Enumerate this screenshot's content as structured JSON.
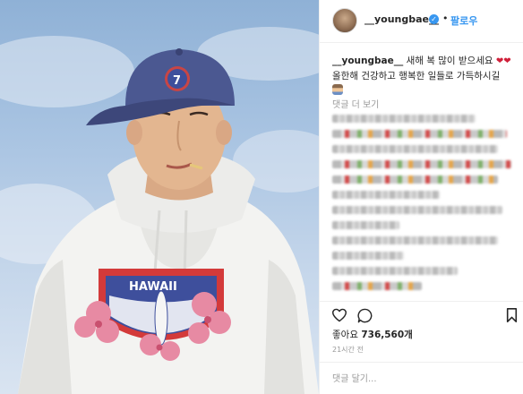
{
  "post": {
    "username": "__youngbae__",
    "verified_icon": "verified-badge-icon",
    "separator": "•",
    "follow_label": "팔로우"
  },
  "caption": {
    "username": "__youngbae__",
    "text_part1": " 새해 복 많이 받으세요 ",
    "text_part2": "올한해 건강하고 행복한 일들로 가득하시길",
    "emoji_heart": "❤❤",
    "emoji_person": "person-emoji"
  },
  "more_comments_label": "댓글 더 보기",
  "actions": {
    "like_icon": "heart-icon",
    "comment_icon": "comment-icon",
    "save_icon": "bookmark-icon"
  },
  "likes": {
    "label": "좋아요",
    "count": "736,560개"
  },
  "timestamp": "21시간 전",
  "comment_input": {
    "placeholder": "댓글 달기..."
  },
  "photo": {
    "cap_letter": "7",
    "sweatshirt_text": "HAWAII"
  },
  "colors": {
    "accent": "#3897f0",
    "text": "#262626",
    "muted": "#999999",
    "border": "#efefef"
  }
}
